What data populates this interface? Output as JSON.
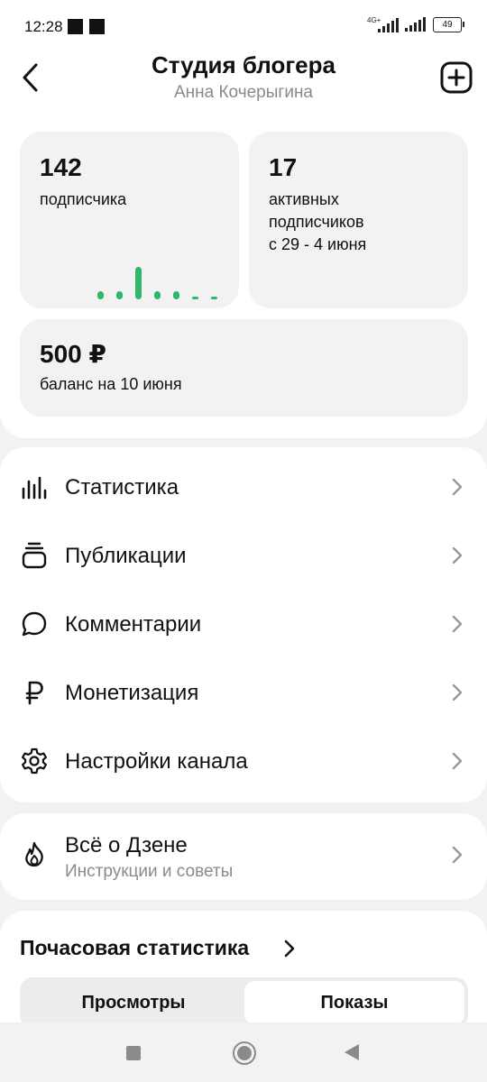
{
  "status_bar": {
    "time": "12:28",
    "network": "4G+",
    "battery": "49"
  },
  "header": {
    "title": "Студия блогера",
    "subtitle": "Анна Кочерыгина"
  },
  "cards": {
    "subscribers": {
      "value": "142",
      "label": "подписчика"
    },
    "active": {
      "value": "17",
      "label_lines": [
        "активных",
        "подписчиков",
        "с 29 - 4 июня"
      ]
    },
    "balance": {
      "value": "500 ₽",
      "label": "баланс на 10 июня"
    }
  },
  "mini_chart": {
    "color": "#2fb86a",
    "values": [
      1,
      1,
      4,
      1,
      1,
      0,
      0
    ]
  },
  "menu": {
    "items": [
      {
        "label": "Статистика",
        "icon": "bar-chart-icon"
      },
      {
        "label": "Публикации",
        "icon": "stack-icon"
      },
      {
        "label": "Комментарии",
        "icon": "comment-icon"
      },
      {
        "label": "Монетизация",
        "icon": "ruble-icon"
      },
      {
        "label": "Настройки канала",
        "icon": "gear-icon"
      }
    ]
  },
  "about": {
    "title": "Всё о Дзене",
    "subtitle": "Инструкции и советы",
    "icon": "flame-icon"
  },
  "hourly": {
    "title": "Почасовая статистика",
    "tabs": [
      "Просмотры",
      "Показы"
    ],
    "selected_tab": "Показы"
  }
}
